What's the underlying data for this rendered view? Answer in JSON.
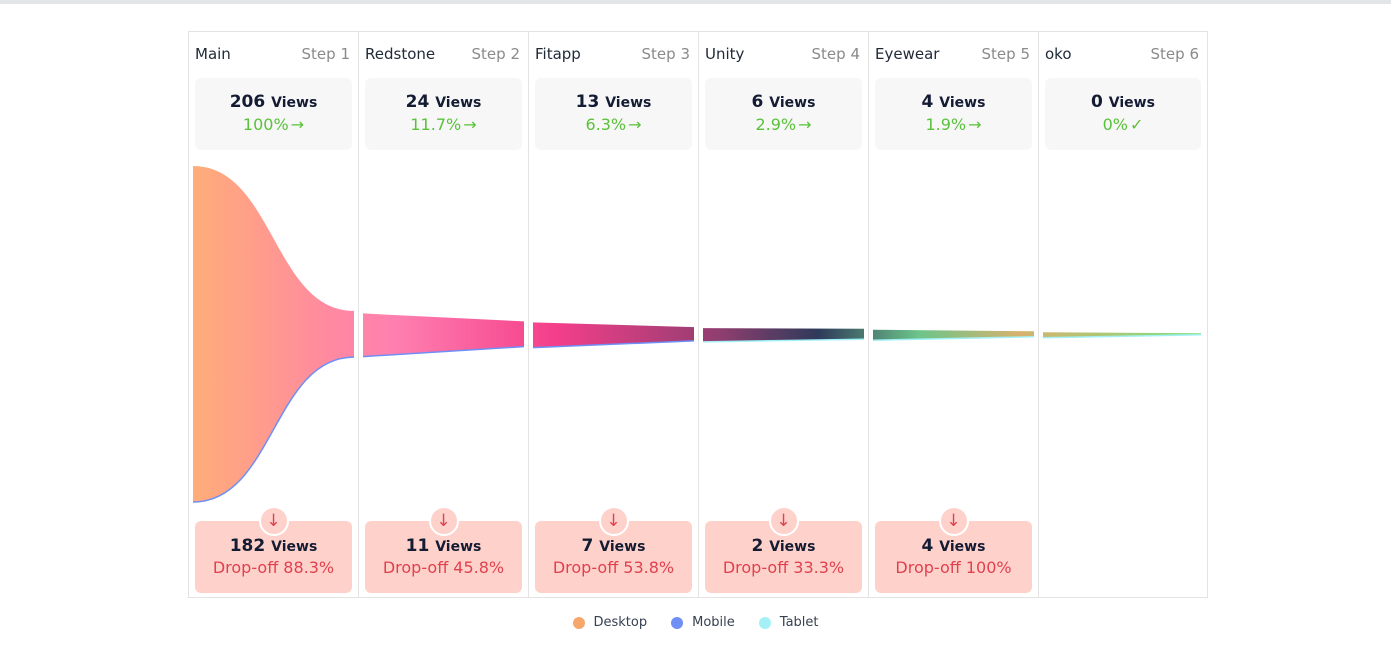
{
  "chart_data": {
    "type": "funnel",
    "title": "",
    "unit_label": "Views",
    "steps": [
      {
        "name": "Main",
        "step_label": "Step 1",
        "views": 206,
        "conversion": "100%",
        "status_icon": "arrow-right-icon",
        "dropoff_views": 182,
        "dropoff_label": "Drop-off 88.3%",
        "dropoff_pct": 88.3
      },
      {
        "name": "Redstone",
        "step_label": "Step 2",
        "views": 24,
        "conversion": "11.7%",
        "status_icon": "arrow-right-icon",
        "dropoff_views": 11,
        "dropoff_label": "Drop-off 45.8%",
        "dropoff_pct": 45.8
      },
      {
        "name": "Fitapp",
        "step_label": "Step 3",
        "views": 13,
        "conversion": "6.3%",
        "status_icon": "arrow-right-icon",
        "dropoff_views": 7,
        "dropoff_label": "Drop-off 53.8%",
        "dropoff_pct": 53.8
      },
      {
        "name": "Unity",
        "step_label": "Step 4",
        "views": 6,
        "conversion": "2.9%",
        "status_icon": "arrow-right-icon",
        "dropoff_views": 2,
        "dropoff_label": "Drop-off 33.3%",
        "dropoff_pct": 33.3
      },
      {
        "name": "Eyewear",
        "step_label": "Step 5",
        "views": 4,
        "conversion": "1.9%",
        "status_icon": "arrow-right-icon",
        "dropoff_views": 4,
        "dropoff_label": "Drop-off 100%",
        "dropoff_pct": 100
      },
      {
        "name": "oko",
        "step_label": "Step 6",
        "views": 0,
        "conversion": "0%",
        "status_icon": "check-icon",
        "dropoff_views": null,
        "dropoff_label": null,
        "dropoff_pct": null
      }
    ],
    "legend": [
      {
        "name": "Desktop",
        "color": "#f7a76c"
      },
      {
        "name": "Mobile",
        "color": "#6f8ff5"
      },
      {
        "name": "Tablet",
        "color": "#a3f1f7"
      }
    ],
    "gradient_stops": [
      "#ffad79",
      "#ff86a4",
      "#ff80b0",
      "#f43e8a",
      "#923e70",
      "#2e3a5a",
      "#6cc48a",
      "#d6b26e",
      "#7fe07f"
    ],
    "legend_position": "bottom-center"
  },
  "icons": {
    "arrow_right": "→",
    "check": "✓",
    "arrow_down": "↓"
  }
}
